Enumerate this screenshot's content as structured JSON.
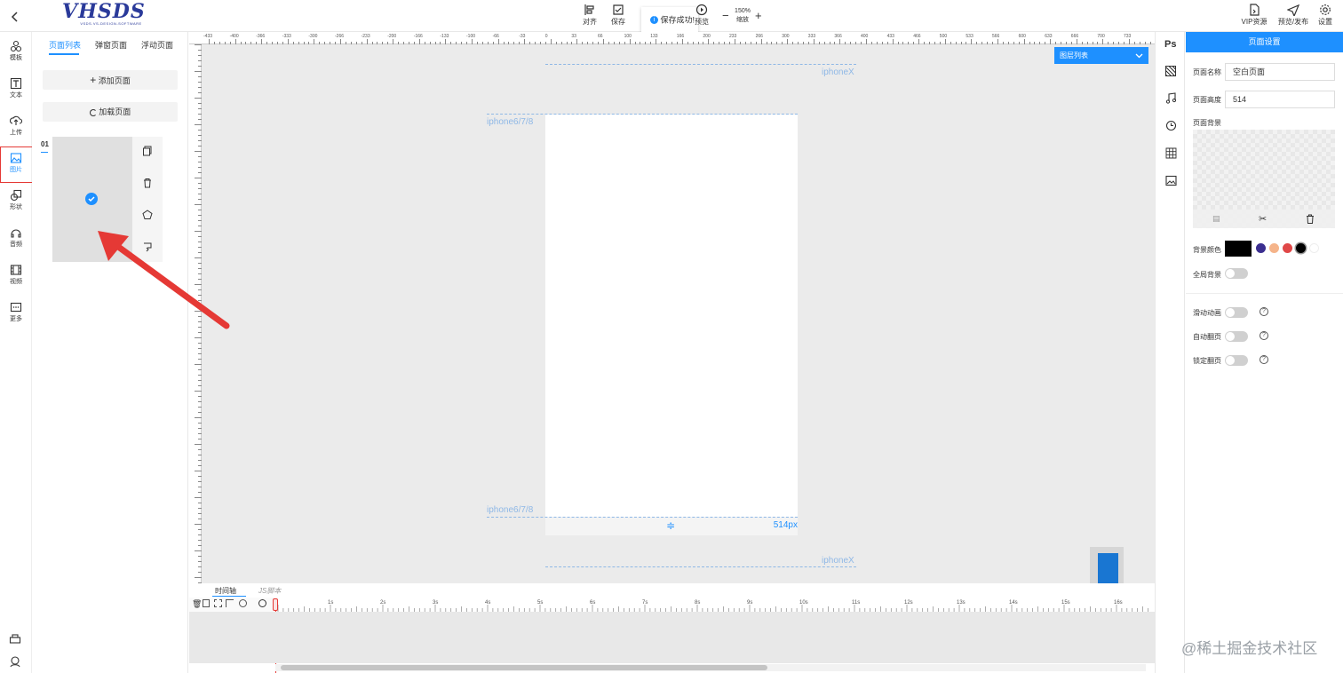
{
  "brand": {
    "logo_text": "VHSDS",
    "logo_sub": "VSDS.VS-DESIGN-SOFTWARE"
  },
  "toolbar": {
    "align_label": "对齐",
    "save_label": "保存",
    "preview_label": "预览",
    "zoom_value": "150%",
    "zoom_label": "缩放",
    "vip_label": "VIP资源",
    "publish_label": "预览/发布",
    "settings_label": "设置",
    "toast": "保存成功!"
  },
  "rail": {
    "items": [
      {
        "label": "模板",
        "icon": "template-icon"
      },
      {
        "label": "文本",
        "icon": "text-icon"
      },
      {
        "label": "上传",
        "icon": "upload-icon"
      },
      {
        "label": "图片",
        "icon": "image-icon"
      },
      {
        "label": "形状",
        "icon": "shape-icon"
      },
      {
        "label": "音频",
        "icon": "audio-icon"
      },
      {
        "label": "视频",
        "icon": "video-icon"
      },
      {
        "label": "更多",
        "icon": "more-icon"
      }
    ]
  },
  "left_panel": {
    "tabs": [
      "页面列表",
      "弹窗页面",
      "浮动页面"
    ],
    "add_page": "添加页面",
    "load_page": "加载页面",
    "page_number": "01"
  },
  "canvas": {
    "ruler_top_ticks": [
      "-433",
      "-400",
      "-366",
      "-333",
      "-300",
      "-266",
      "-233",
      "-200",
      "-166",
      "-133",
      "-100",
      "-66",
      "-33",
      "0",
      "33",
      "66",
      "100",
      "133",
      "166",
      "200",
      "233",
      "266",
      "300",
      "333",
      "366",
      "400",
      "433",
      "466",
      "500",
      "533",
      "566",
      "600",
      "633",
      "666",
      "700",
      "733"
    ],
    "guide_iphonex": "iphoneX",
    "guide_iphone6": "iphone6/7/8",
    "page_height_label": "514px",
    "layer_list_label": "图层列表"
  },
  "timeline": {
    "tab_timeline": "时间轴",
    "tab_js": "JS脚本",
    "seconds": [
      "1s",
      "2s",
      "3s",
      "4s",
      "5s",
      "6s",
      "7s",
      "8s",
      "9s",
      "10s",
      "11s",
      "12s",
      "13s",
      "14s",
      "15s",
      "16s"
    ]
  },
  "right_tools": {
    "ps_label": "Ps"
  },
  "right_panel": {
    "header": "页面设置",
    "name_label": "页面名称",
    "name_value": "空白页面",
    "height_label": "页面高度",
    "height_value": "514",
    "bg_label": "页面背景",
    "bg_color_label": "背景颜色",
    "global_bg_label": "全局背景",
    "slide_anim_label": "滑动动画",
    "auto_flip_label": "自动翻页",
    "lock_flip_label": "锁定翻页",
    "swatches": [
      "#000000",
      "#3b2e8f",
      "#f5b48a",
      "#e04848",
      "#000000",
      "#ffffff"
    ]
  },
  "watermark": "@稀土掘金技术社区",
  "colors": {
    "accent": "#1e90ff",
    "highlight_box": "#e53935",
    "arrow": "#e53935"
  }
}
